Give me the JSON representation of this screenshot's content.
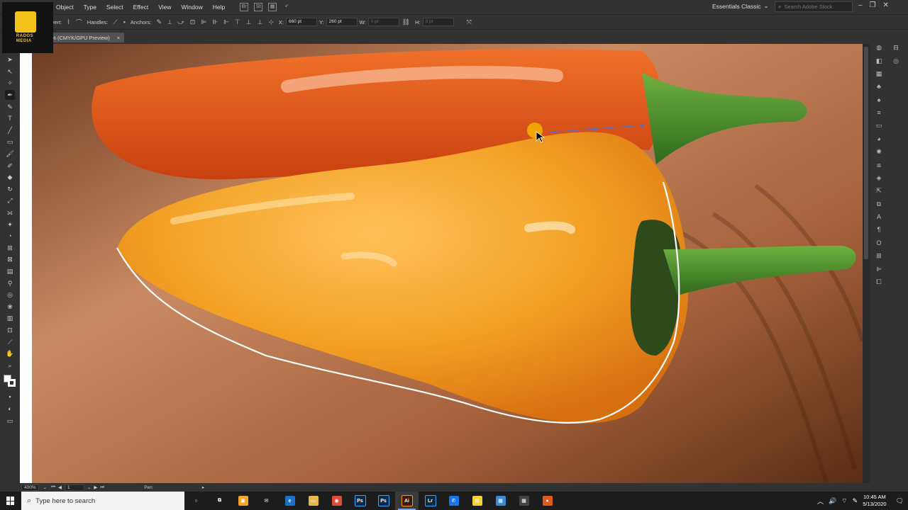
{
  "menubar": {
    "items": [
      "Object",
      "Type",
      "Select",
      "Effect",
      "View",
      "Window",
      "Help"
    ],
    "icons": [
      "bridge-icon",
      "stock-icon",
      "arrange-documents-icon",
      "gpu-rocket-icon"
    ],
    "bridge_label": "Br",
    "stock_label": "St",
    "workspace": "Essentials Classic",
    "stock_search_placeholder": "Search Adobe Stock"
  },
  "controlbar": {
    "convert_label": "Convert:",
    "handles_label": "Handles:",
    "anchors_label": "Anchors:",
    "x_label": "X:",
    "x_value": "660 pt",
    "y_label": "Y:",
    "y_value": "260 pt",
    "w_label": "W:",
    "w_value": "0 pt",
    "h_label": "H:",
    "h_value": "0 pt"
  },
  "logo": {
    "text_line1": "RADOS",
    "text_line2": "MEDIA"
  },
  "document_tab": {
    "title": "@ 400% (CMYK/GPU Preview)",
    "close": "×"
  },
  "statusbar": {
    "zoom": "400%",
    "artboard": "1",
    "tool": "Pen"
  },
  "taskbar": {
    "search_placeholder": "Type here to search",
    "apps": [
      {
        "name": "cortana-icon",
        "label": "○",
        "color": "#1c1c1c"
      },
      {
        "name": "task-view-icon",
        "label": "⧉",
        "color": "#1c1c1c"
      },
      {
        "name": "store-icon",
        "label": "▣",
        "color": "#f5a623"
      },
      {
        "name": "mail-icon",
        "label": "✉",
        "color": "#1c1c1c"
      },
      {
        "name": "edge-icon",
        "label": "e",
        "color": "#1a73c8"
      },
      {
        "name": "file-explorer-icon",
        "label": "▭",
        "color": "#e8b84a"
      },
      {
        "name": "chrome-icon",
        "label": "◉",
        "color": "#dd4b39"
      },
      {
        "name": "photoshop-icon",
        "label": "Ps",
        "color": "#0b2a4a"
      },
      {
        "name": "photoshop-alt-icon",
        "label": "Ps",
        "color": "#0b2a4a"
      },
      {
        "name": "illustrator-icon",
        "label": "Ai",
        "color": "#3a1a05"
      },
      {
        "name": "lightroom-icon",
        "label": "Lr",
        "color": "#0a2a3a"
      },
      {
        "name": "messenger-icon",
        "label": "✆",
        "color": "#1a73e8"
      },
      {
        "name": "sticky-notes-icon",
        "label": "▤",
        "color": "#f5d033"
      },
      {
        "name": "window-app-icon",
        "label": "▦",
        "color": "#3a8ad4"
      },
      {
        "name": "calculator-icon",
        "label": "▦",
        "color": "#444444"
      },
      {
        "name": "recorder-icon",
        "label": "●",
        "color": "#e05a1a"
      }
    ],
    "active_app_index": 9,
    "time": "10:45 AM",
    "date": "5/13/2020"
  },
  "colors": {
    "ui_dark": "#323232",
    "pepper_orange": "#f0a028",
    "pepper_red": "#e8521e",
    "stem_green": "#3f8a2a",
    "path_white": "#ffffff",
    "cursor_highlight": "#f5b400"
  }
}
